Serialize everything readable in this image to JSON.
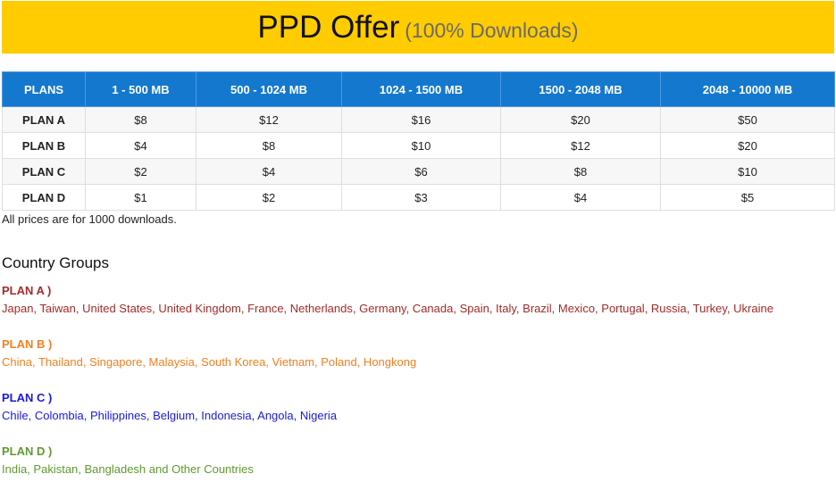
{
  "header": {
    "title": "PPD Offer",
    "subtitle": "(100% Downloads)",
    "background_color": "#fecc00"
  },
  "pricing_table": {
    "header_color": "#1478cf",
    "columns": [
      "PLANS",
      "1 - 500 MB",
      "500 - 1024 MB",
      "1024 - 1500 MB",
      "1500 - 2048 MB",
      "2048 - 10000 MB"
    ],
    "rows": [
      {
        "plan": "PLAN A",
        "prices": [
          "$8",
          "$12",
          "$16",
          "$20",
          "$50"
        ]
      },
      {
        "plan": "PLAN B",
        "prices": [
          "$4",
          "$8",
          "$10",
          "$12",
          "$20"
        ]
      },
      {
        "plan": "PLAN C",
        "prices": [
          "$2",
          "$4",
          "$6",
          "$8",
          "$10"
        ]
      },
      {
        "plan": "PLAN D",
        "prices": [
          "$1",
          "$2",
          "$3",
          "$4",
          "$5"
        ]
      }
    ],
    "note": "All prices are for 1000 downloads."
  },
  "country_groups": {
    "heading": "Country Groups",
    "groups": [
      {
        "label": "PLAN A )",
        "countries": "Japan, Taiwan, United States, United Kingdom, France, Netherlands, Germany, Canada, Spain, Italy, Brazil, Mexico, Portugal, Russia, Turkey, Ukraine",
        "color": "#a52a2a"
      },
      {
        "label": "PLAN B )",
        "countries": "China, Thailand, Singapore, Malaysia, South Korea, Vietnam, Poland, Hongkong",
        "color": "#f37f22"
      },
      {
        "label": "PLAN C )",
        "countries": "Chile, Colombia, Philippines, Belgium, Indonesia, Angola, Nigeria",
        "color": "#1a1add"
      },
      {
        "label": "PLAN D )",
        "countries": "India, Pakistan, Bangladesh and Other Countries",
        "color": "#5f9a2f"
      }
    ]
  }
}
